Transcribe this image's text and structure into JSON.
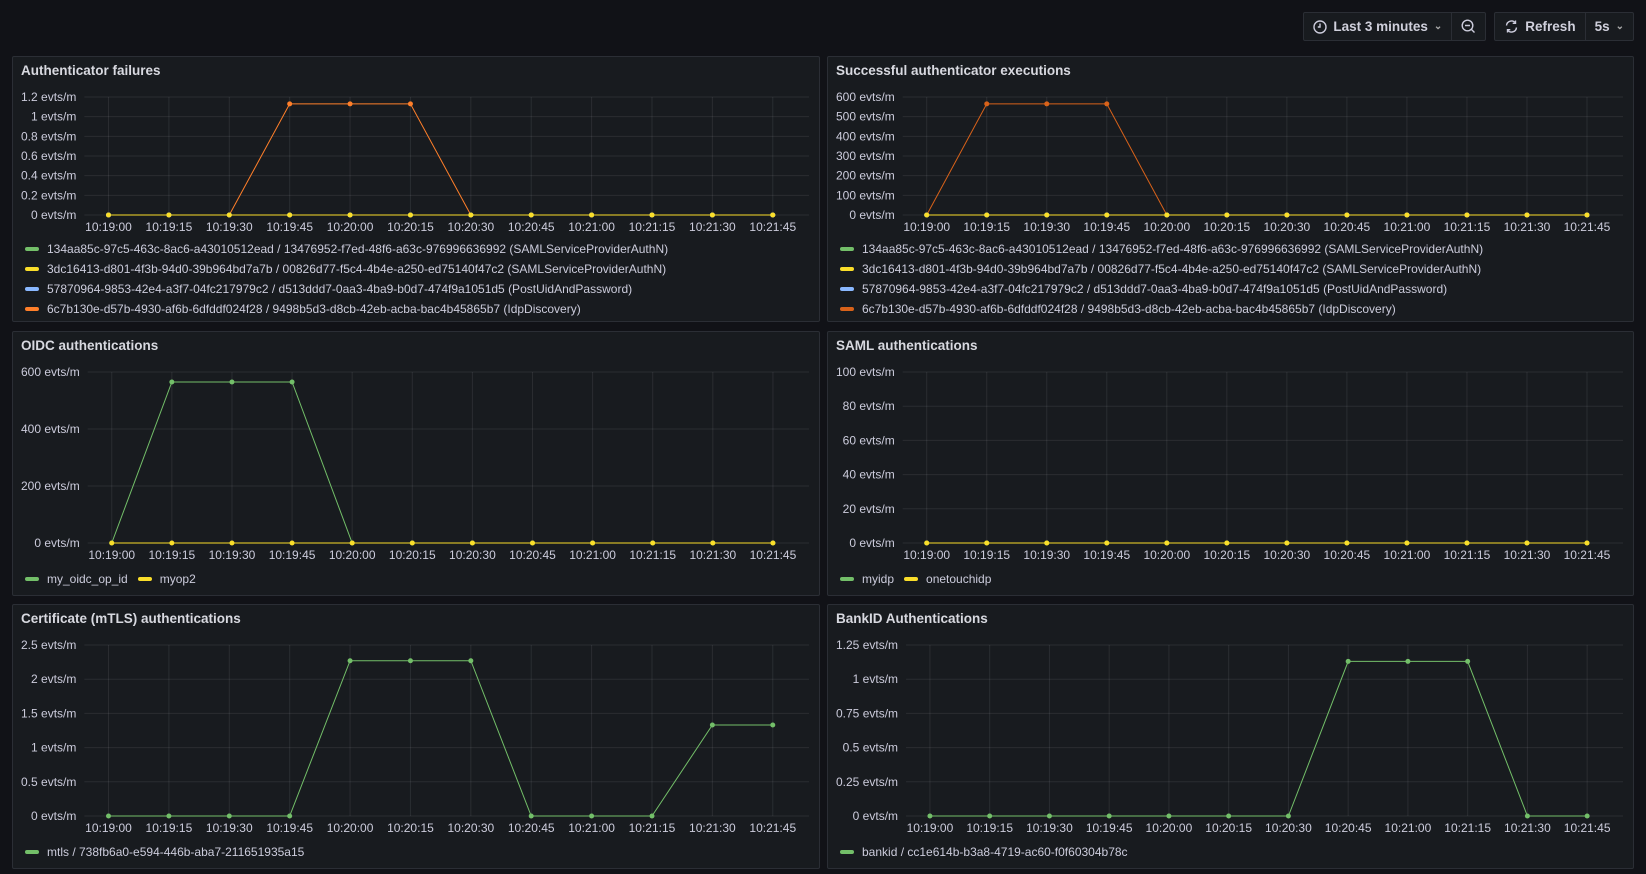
{
  "toolbar": {
    "time_range": "Last 3 minutes",
    "refresh_label": "Refresh",
    "refresh_interval": "5s",
    "icons": [
      "clock-icon",
      "chevron-down-icon",
      "zoom-out-icon",
      "refresh-icon"
    ]
  },
  "colors": {
    "background": "#111217",
    "panel": "#181b1f",
    "green": "#73bf69",
    "yellow": "#fade2a",
    "blue": "#8ab8ff",
    "orange": "#ff7f2a"
  },
  "panels": [
    {
      "title": "Authenticator failures"
    },
    {
      "title": "Successful authenticator executions"
    },
    {
      "title": "OIDC authentications"
    },
    {
      "title": "SAML authentications"
    },
    {
      "title": "Certificate (mTLS) authentications"
    },
    {
      "title": "BankID Authentications"
    }
  ],
  "chart_data": [
    {
      "type": "line",
      "title": "Authenticator failures",
      "unit": "evts/m",
      "x": [
        "10:19:00",
        "10:19:15",
        "10:19:30",
        "10:19:45",
        "10:20:00",
        "10:20:15",
        "10:20:30",
        "10:20:45",
        "10:21:00",
        "10:21:15",
        "10:21:30",
        "10:21:45"
      ],
      "xlim": [
        "10:18:54",
        "10:21:54"
      ],
      "ylim": [
        0,
        1.2
      ],
      "y_ticks": [
        0,
        0.2,
        0.4,
        0.6,
        0.8,
        1,
        1.2
      ],
      "grid": true,
      "legend": "bottom-list",
      "series": [
        {
          "name": "134aa85c-97c5-463c-8ac6-a43010512ead / 13476952-f7ed-48f6-a63c-976996636992 (SAMLServiceProviderAuthN)",
          "color": "#73bf69",
          "values": [
            0,
            0,
            0,
            0,
            0,
            0,
            0,
            0,
            0,
            0,
            0,
            0
          ]
        },
        {
          "name": "3dc16413-d801-4f3b-94d0-39b964bd7a7b / 00826d77-f5c4-4b4e-a250-ed75140f47c2 (SAMLServiceProviderAuthN)",
          "color": "#fade2a",
          "values": [
            0,
            0,
            0,
            0,
            0,
            0,
            0,
            0,
            0,
            0,
            0,
            0
          ]
        },
        {
          "name": "57870964-9853-42e4-a3f7-04fc217979c2 / d513ddd7-0aa3-4ba9-b0d7-474f9a1051d5 (PostUidAndPassword)",
          "color": "#8ab8ff",
          "values": [
            0,
            0,
            0,
            0,
            0,
            0,
            0,
            0,
            0,
            0,
            0,
            0
          ]
        },
        {
          "name": "6c7b130e-d57b-4930-af6b-6dfddf024f28 / 9498b5d3-d8cb-42eb-acba-bac4b45865b7 (IdpDiscovery)",
          "color": "#ff7f2a",
          "values": [
            0,
            0,
            0,
            1.13,
            1.13,
            1.13,
            0,
            0,
            0,
            0,
            0,
            0
          ]
        }
      ]
    },
    {
      "type": "line",
      "title": "Successful authenticator executions",
      "unit": "evts/m",
      "x": [
        "10:19:00",
        "10:19:15",
        "10:19:30",
        "10:19:45",
        "10:20:00",
        "10:20:15",
        "10:20:30",
        "10:20:45",
        "10:21:00",
        "10:21:15",
        "10:21:30",
        "10:21:45"
      ],
      "xlim": [
        "10:18:54",
        "10:21:54"
      ],
      "ylim": [
        0,
        600
      ],
      "y_ticks": [
        0,
        100,
        200,
        300,
        400,
        500,
        600
      ],
      "grid": true,
      "legend": "bottom-list",
      "series": [
        {
          "name": "134aa85c-97c5-463c-8ac6-a43010512ead / 13476952-f7ed-48f6-a63c-976996636992 (SAMLServiceProviderAuthN)",
          "color": "#73bf69",
          "values": [
            0,
            0,
            0,
            0,
            0,
            0,
            0,
            0,
            0,
            0,
            0,
            0
          ]
        },
        {
          "name": "3dc16413-d801-4f3b-94d0-39b964bd7a7b / 00826d77-f5c4-4b4e-a250-ed75140f47c2 (SAMLServiceProviderAuthN)",
          "color": "#fade2a",
          "values": [
            0,
            0,
            0,
            0,
            0,
            0,
            0,
            0,
            0,
            0,
            0,
            0
          ]
        },
        {
          "name": "57870964-9853-42e4-a3f7-04fc217979c2 / d513ddd7-0aa3-4ba9-b0d7-474f9a1051d5 (PostUidAndPassword)",
          "color": "#8ab8ff",
          "values": [
            0,
            0,
            0,
            0,
            0,
            0,
            0,
            0,
            0,
            0,
            0,
            0
          ]
        },
        {
          "name": "6c7b130e-d57b-4930-af6b-6dfddf024f28 / 9498b5d3-d8cb-42eb-acba-bac4b45865b7 (IdpDiscovery)",
          "color": "#d8621a",
          "values": [
            0,
            565,
            565,
            565,
            0,
            0,
            0,
            0,
            0,
            0,
            0,
            0
          ]
        }
      ]
    },
    {
      "type": "line",
      "title": "OIDC authentications",
      "unit": "evts/m",
      "x": [
        "10:19:00",
        "10:19:15",
        "10:19:30",
        "10:19:45",
        "10:20:00",
        "10:20:15",
        "10:20:30",
        "10:20:45",
        "10:21:00",
        "10:21:15",
        "10:21:30",
        "10:21:45"
      ],
      "xlim": [
        "10:18:54",
        "10:21:54"
      ],
      "ylim": [
        0,
        600
      ],
      "y_ticks": [
        0,
        200,
        400,
        600
      ],
      "grid": true,
      "legend": "bottom-inline",
      "series": [
        {
          "name": "my_oidc_op_id",
          "color": "#73bf69",
          "values": [
            0,
            565,
            565,
            565,
            0,
            0,
            0,
            0,
            0,
            0,
            0,
            0
          ]
        },
        {
          "name": "myop2",
          "color": "#fade2a",
          "values": [
            0,
            0,
            0,
            0,
            0,
            0,
            0,
            0,
            0,
            0,
            0,
            0
          ]
        }
      ]
    },
    {
      "type": "line",
      "title": "SAML authentications",
      "unit": "evts/m",
      "x": [
        "10:19:00",
        "10:19:15",
        "10:19:30",
        "10:19:45",
        "10:20:00",
        "10:20:15",
        "10:20:30",
        "10:20:45",
        "10:21:00",
        "10:21:15",
        "10:21:30",
        "10:21:45"
      ],
      "xlim": [
        "10:18:54",
        "10:21:54"
      ],
      "ylim": [
        0,
        100
      ],
      "y_ticks": [
        0,
        20,
        40,
        60,
        80,
        100
      ],
      "grid": true,
      "legend": "bottom-inline",
      "series": [
        {
          "name": "myidp",
          "color": "#73bf69",
          "values": [
            0,
            0,
            0,
            0,
            0,
            0,
            0,
            0,
            0,
            0,
            0,
            0
          ]
        },
        {
          "name": "onetouchidp",
          "color": "#fade2a",
          "values": [
            0,
            0,
            0,
            0,
            0,
            0,
            0,
            0,
            0,
            0,
            0,
            0
          ]
        }
      ]
    },
    {
      "type": "line",
      "title": "Certificate (mTLS) authentications",
      "unit": "evts/m",
      "x": [
        "10:19:00",
        "10:19:15",
        "10:19:30",
        "10:19:45",
        "10:20:00",
        "10:20:15",
        "10:20:30",
        "10:20:45",
        "10:21:00",
        "10:21:15",
        "10:21:30",
        "10:21:45"
      ],
      "xlim": [
        "10:18:54",
        "10:21:54"
      ],
      "ylim": [
        0,
        2.5
      ],
      "y_ticks": [
        0,
        0.5,
        1,
        1.5,
        2,
        2.5
      ],
      "grid": true,
      "legend": "bottom-inline",
      "series": [
        {
          "name": "mtls / 738fb6a0-e594-446b-aba7-211651935a15",
          "color": "#73bf69",
          "values": [
            0,
            0,
            0,
            0,
            2.27,
            2.27,
            2.27,
            0,
            0,
            0,
            1.33,
            1.33
          ]
        }
      ]
    },
    {
      "type": "line",
      "title": "BankID Authentications",
      "unit": "evts/m",
      "x": [
        "10:19:00",
        "10:19:15",
        "10:19:30",
        "10:19:45",
        "10:20:00",
        "10:20:15",
        "10:20:30",
        "10:20:45",
        "10:21:00",
        "10:21:15",
        "10:21:30",
        "10:21:45"
      ],
      "xlim": [
        "10:18:54",
        "10:21:54"
      ],
      "ylim": [
        0,
        1.25
      ],
      "y_ticks": [
        0,
        0.25,
        0.5,
        0.75,
        1,
        1.25
      ],
      "grid": true,
      "legend": "bottom-inline",
      "series": [
        {
          "name": "bankid / cc1e614b-b3a8-4719-ac60-f0f60304b78c",
          "color": "#73bf69",
          "values": [
            0,
            0,
            0,
            0,
            0,
            0,
            0,
            1.13,
            1.13,
            1.13,
            0,
            0
          ]
        }
      ]
    }
  ]
}
